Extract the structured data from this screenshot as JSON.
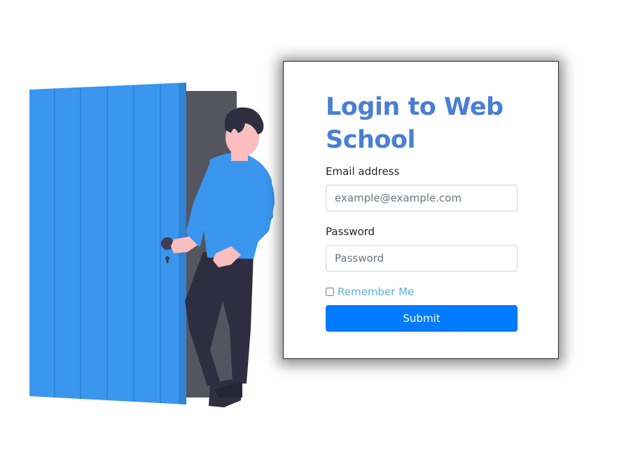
{
  "login": {
    "title": "Login to Web School",
    "email_label": "Email address",
    "email_placeholder": "example@example.com",
    "email_value": "",
    "password_label": "Password",
    "password_placeholder": "Password",
    "password_value": "",
    "remember_label": "Remember Me",
    "remember_checked": false,
    "submit_label": "Submit"
  },
  "colors": {
    "title": "#4a7fd4",
    "submit_bg": "#007bff",
    "remember_text": "#5bb0e0",
    "door": "#3a96ee",
    "door_frame": "#55555f"
  }
}
